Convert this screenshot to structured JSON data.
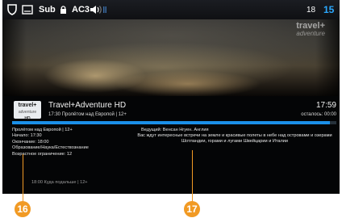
{
  "statusbar": {
    "shield_icon": "shield-icon",
    "subtitle_icon": "subtitle-icon",
    "sub_label": "Sub",
    "lock_icon": "lock-icon",
    "audio_label": "AC3",
    "volume_icon": "volume-icon",
    "channel_label": "18",
    "channel_number": "15"
  },
  "video": {
    "logo_line1": "travel+",
    "logo_line2": "adventure"
  },
  "info": {
    "channel_logo": {
      "line1": "travel+",
      "line2": "adventure",
      "line3": "HD"
    },
    "channel_name": "Travel+Adventure HD",
    "clock": "17:59",
    "now_line": "17:30   Пролётом над Европой | 12+",
    "remaining": "осталось: 00:00",
    "progress": 0.98,
    "details": [
      "Пролётом над Европой | 12+",
      "Начало: 17:30",
      "Окончание: 18:00",
      "Образование/Наука/Естествознание",
      "Возрастное ограничение: 12"
    ],
    "cast": "Ведущий: Венсан Нгуен. Англия",
    "description": "Вас ждут интересные встречи на земле и красивые полеты в небе над островами и озерами Шотландии, горами и лугами Швейцарии и Италии",
    "next_line": "18:00   Куда подальше | 12+"
  },
  "callouts": [
    {
      "label": "16"
    },
    {
      "label": "17"
    }
  ],
  "colors": {
    "accent": "#1b8fe8",
    "clock_blue": "#2aa8ff",
    "callout": "#f19a24"
  }
}
